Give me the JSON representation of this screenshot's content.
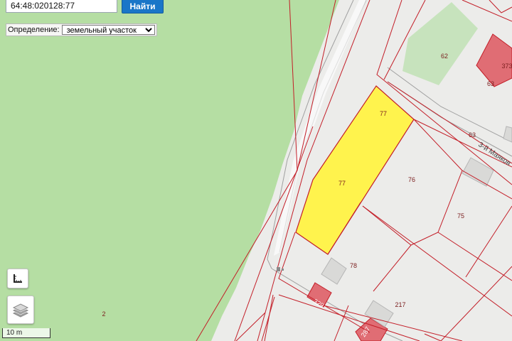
{
  "search": {
    "value": "64:48:020128:77",
    "button_label": "Найти"
  },
  "definition": {
    "label": "Определение:",
    "selected": "земельный участок"
  },
  "map": {
    "street_label": "3-й Маяков",
    "parcel_labels": [
      "77",
      "77",
      "76",
      "75",
      "78",
      "217",
      "62",
      "63",
      "63",
      "2"
    ],
    "building_labels": [
      "373",
      "329",
      "287"
    ],
    "highlighted_parcel": "77",
    "colors": {
      "forest": "#b5dea3",
      "background": "#ececea",
      "boundary": "#c31e28",
      "highlight_fill": "#fff34d",
      "building": "#e06d74",
      "label": "#7a1d1d"
    }
  },
  "scale": {
    "label": "10 m"
  },
  "icons": {
    "measure": "ruler-icon",
    "layers": "layers-icon"
  }
}
